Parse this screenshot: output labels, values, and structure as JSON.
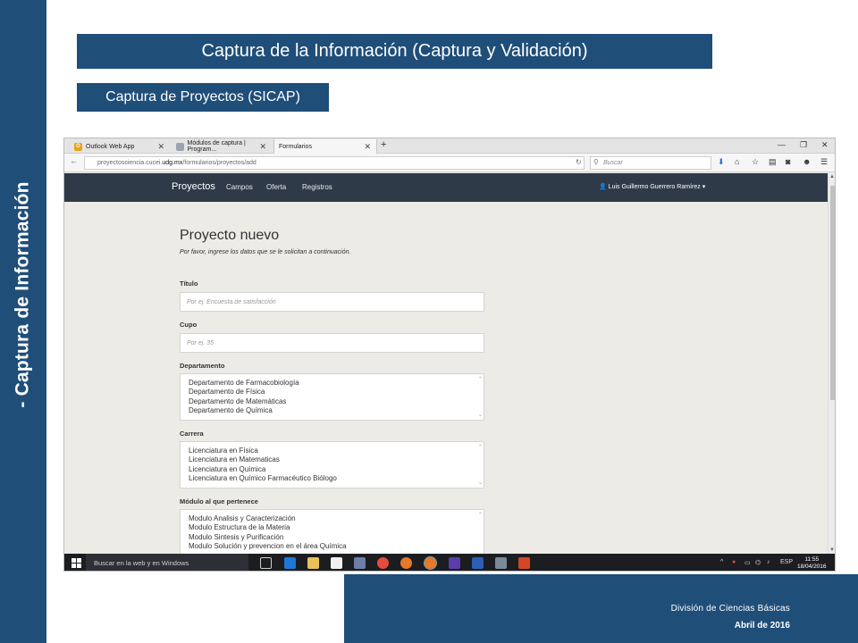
{
  "slide": {
    "side_title": "- Captura de Información",
    "main_banner": "Captura de la Información (Captura y Validación)",
    "sub_banner": "Captura de Proyectos (SICAP)",
    "footer_line1": "División de Ciencias Básicas",
    "footer_line2": "Abril de 2016",
    "accent_color": "#1f4e79"
  },
  "browser": {
    "tabs": [
      {
        "label": "Outlook Web App",
        "icon": "outlook-icon"
      },
      {
        "label": "Módulos de captura | Program...",
        "icon": "page-icon"
      },
      {
        "label": "Formularios",
        "icon": "page-icon"
      }
    ],
    "url_prefix": "proyectosciencia.cucei.",
    "url_domain": "udg.mx",
    "url_path": "/formularios/proyectos/add",
    "search_placeholder": "Buscar"
  },
  "app": {
    "brand": "Proyectos",
    "nav": [
      "Campos",
      "Oferta",
      "Registros"
    ],
    "user": "Luis Guillermo Guerrero Ramírez",
    "header_color": "#2e3a47"
  },
  "form": {
    "title": "Proyecto nuevo",
    "subtitle": "Por favor, ingrese los datos que se le solicitan a continuación.",
    "fields": {
      "titulo_label": "Título",
      "titulo_placeholder": "Por ej. Encuesta de satisfacción",
      "cupo_label": "Cupo",
      "cupo_placeholder": "Por ej. 35",
      "departamento_label": "Departamento",
      "departamento_options": [
        "Departamento de Farmacobiología",
        "Departamento de Física",
        "Departamento de Matemáticas",
        "Departamento de Química"
      ],
      "carrera_label": "Carrera",
      "carrera_options": [
        "Licenciatura en Física",
        "Licenciatura en Matematicas",
        "Licenciatura en Química",
        "Licenciatura en Químico Farmacéutico Biólogo"
      ],
      "modulo_label": "Módulo al que pertenece",
      "modulo_options": [
        "Modulo Analisis y Caracterización",
        "Modulo Estructura de la Materia",
        "Modulo Sintesis y Purificación",
        "Modulo Solución y prevencion en el área Química"
      ]
    }
  },
  "taskbar": {
    "search_text": "Buscar en la web y en Windows",
    "lang": "ESP",
    "time": "11:55",
    "date": "18/04/2016"
  }
}
